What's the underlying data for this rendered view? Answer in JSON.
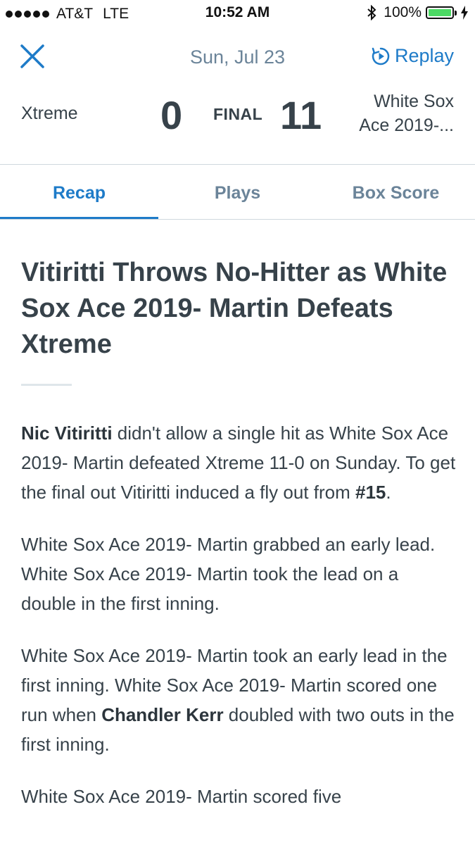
{
  "status_bar": {
    "carrier": "AT&T",
    "network": "LTE",
    "time": "10:52 AM",
    "battery": "100%"
  },
  "nav": {
    "date": "Sun, Jul 23",
    "replay_label": "Replay"
  },
  "score": {
    "away_team": "Xtreme",
    "away_score": "0",
    "status": "FINAL",
    "home_score": "11",
    "home_team_line1": "White Sox",
    "home_team_line2": "Ace 2019-..."
  },
  "tabs": [
    {
      "label": "Recap",
      "active": true
    },
    {
      "label": "Plays",
      "active": false
    },
    {
      "label": "Box Score",
      "active": false
    }
  ],
  "article": {
    "headline": "Vitiritti Throws No-Hitter as White Sox Ace 2019- Martin Defeats Xtreme",
    "p1": {
      "bold1": "Nic Vitiritti",
      "text1": " didn't allow a single hit as White Sox Ace 2019- Martin  defeated Xtreme 11-0 on Sunday. To get the final out Vitiritti induced a fly out from ",
      "bold2": "#15",
      "text2": "."
    },
    "p2": "White Sox Ace 2019- Martin  grabbed an early lead.  White Sox Ace 2019- Martin took the lead on a double in the first inning.",
    "p3": {
      "text1": "White Sox Ace 2019- Martin  took an early lead in the first inning.  White Sox Ace 2019- Martin  scored one run when ",
      "bold1": "Chandler Kerr",
      "text2": " doubled with two outs in the first inning."
    },
    "p4": "White Sox Ace 2019- Martin  scored five"
  },
  "colors": {
    "accent": "#1e7bc8",
    "muted": "#6b8499",
    "text": "#37424a",
    "battery": "#4cd964"
  },
  "icons": [
    "signal-dots-icon",
    "bluetooth-icon",
    "battery-icon",
    "charging-icon",
    "close-icon",
    "replay-icon"
  ]
}
